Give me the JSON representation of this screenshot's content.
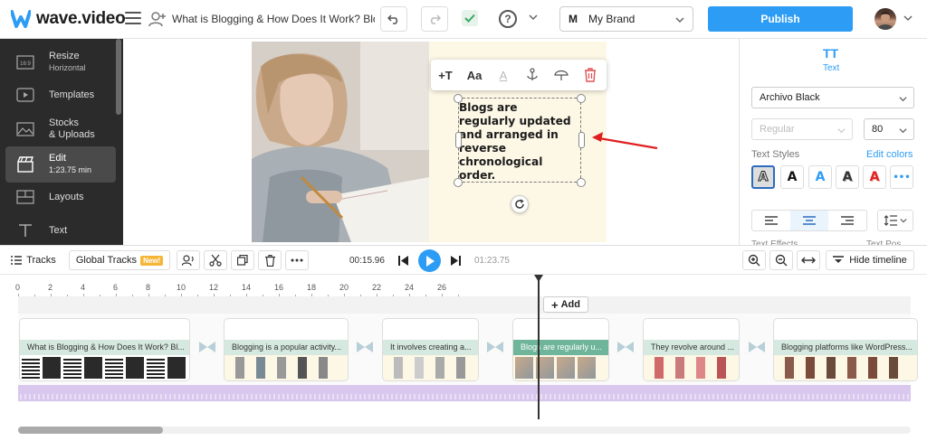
{
  "app": {
    "logo_text": "wave.video",
    "project_title": "What is Blogging & How Does It Work? Blogging",
    "brand": "My Brand",
    "brand_initial": "M",
    "publish_label": "Publish",
    "accent_color": "#2d9cf4"
  },
  "sidebar": {
    "items": [
      {
        "label": "Resize",
        "sub": "Horizontal",
        "icon": "resize-icon",
        "icon_text": "16:9"
      },
      {
        "label": "Templates",
        "sub": "",
        "icon": "templates-icon"
      },
      {
        "label": "Stocks",
        "sub": "& Uploads",
        "icon": "stocks-icon"
      },
      {
        "label": "Edit",
        "sub": "1:23.75 min",
        "icon": "edit-icon",
        "active": true
      },
      {
        "label": "Layouts",
        "sub": "",
        "icon": "layouts-icon"
      },
      {
        "label": "Text",
        "sub": "",
        "icon": "text-icon"
      }
    ]
  },
  "canvas": {
    "caption": "Blogs are regularly updated and arranged in reverse chronological order.",
    "caption_lines": [
      "Blogs are",
      "regularly updated",
      "and arranged in",
      "reverse",
      "chronological",
      "order."
    ],
    "toolbar": {
      "add_text": "+T",
      "font": "Aa",
      "color": "A"
    }
  },
  "right_panel": {
    "tab_label": "Text",
    "tab_icon": "TT",
    "font_family": "Archivo Black",
    "font_weight": "Regular",
    "font_size": "80",
    "text_styles_label": "Text Styles",
    "edit_colors_label": "Edit colors",
    "style_glyph": "A",
    "more_glyph": "•••",
    "effects_label": "Text Effects",
    "effects_label2": "Text Pos"
  },
  "timeline": {
    "tracks_label": "Tracks",
    "global_tracks_label": "Global Tracks",
    "new_badge": "New!",
    "current_time": "00:15.96",
    "total_time": "01:23.75",
    "hide_label": "Hide timeline",
    "add_label": "Add",
    "ruler_ticks": [
      "0",
      "2",
      "4",
      "6",
      "8",
      "10",
      "12",
      "14",
      "16",
      "18",
      "20",
      "22",
      "24",
      "26"
    ],
    "clips": [
      {
        "title": "What is Blogging & How Does It Work? Bl..."
      },
      {
        "title": "Blogging is a popular activity..."
      },
      {
        "title": "It involves creating a..."
      },
      {
        "title": "Blogs are regularly u...",
        "active": true
      },
      {
        "title": "They revolve around ..."
      },
      {
        "title": "Blogging platforms like WordPress..."
      }
    ]
  }
}
